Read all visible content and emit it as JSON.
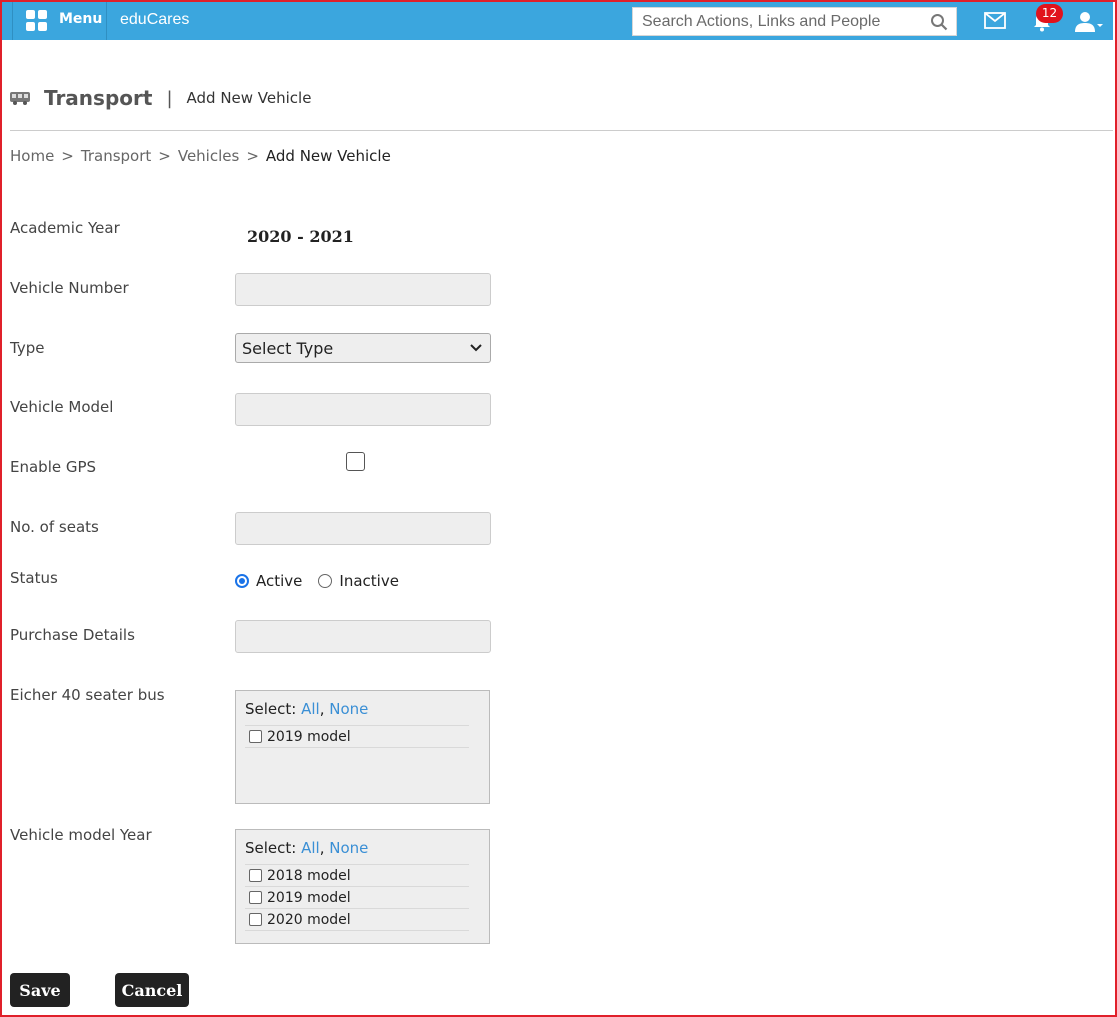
{
  "topbar": {
    "menu_label": "Menu",
    "brand": "eduCares",
    "search_placeholder": "Search Actions, Links and People",
    "notification_count": "12",
    "accent_color": "#3ba6de"
  },
  "header": {
    "title": "Transport",
    "subtitle": "Add New Vehicle"
  },
  "breadcrumb": [
    "Home",
    "Transport",
    "Vehicles",
    "Add New Vehicle"
  ],
  "form": {
    "academic_year_label": "Academic Year",
    "academic_year_value": "2020 - 2021",
    "vehicle_number_label": "Vehicle Number",
    "type_label": "Type",
    "type_selected": "Select Type",
    "vehicle_model_label": "Vehicle Model",
    "enable_gps_label": "Enable GPS",
    "enable_gps_checked": false,
    "seats_label": "No. of seats",
    "status_label": "Status",
    "status_options": [
      "Active",
      "Inactive"
    ],
    "status_selected": "Active",
    "purchase_label": "Purchase Details",
    "group1": {
      "label": "Eicher 40 seater bus",
      "select_text": "Select:",
      "all": "All",
      "none": "None",
      "options": [
        "2019 model"
      ]
    },
    "group2": {
      "label": "Vehicle model Year",
      "select_text": "Select:",
      "all": "All",
      "none": "None",
      "options": [
        "2018 model",
        "2019 model",
        "2020 model"
      ]
    }
  },
  "actions": {
    "save": "Save",
    "cancel": "Cancel"
  }
}
